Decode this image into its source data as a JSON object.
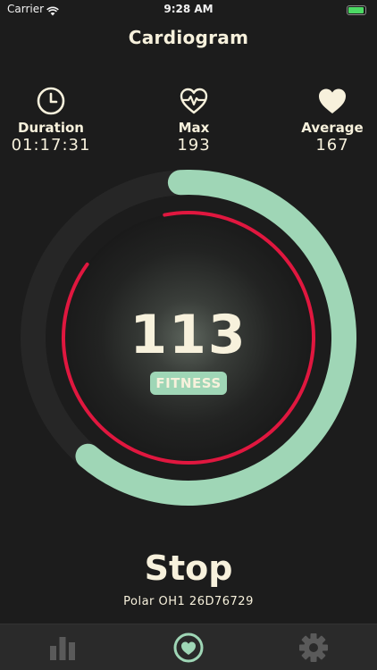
{
  "status_bar": {
    "carrier": "Carrier",
    "time": "9:28 AM"
  },
  "title": "Cardiogram",
  "stats": {
    "duration": {
      "label": "Duration",
      "value": "01:17:31",
      "icon": "clock-icon"
    },
    "max": {
      "label": "Max",
      "value": "193",
      "icon": "heartbeat-outline-icon"
    },
    "average": {
      "label": "Average",
      "value": "167",
      "icon": "heart-filled-icon"
    }
  },
  "gauge": {
    "bpm": "113",
    "zone": "FITNESS",
    "outer_progress_percent": 62,
    "inner_ring_percent": 88
  },
  "stop_label": "Stop",
  "device": "Polar OH1 26D76729",
  "tabs": [
    {
      "name": "stats",
      "icon": "bar-chart-icon",
      "active": false
    },
    {
      "name": "heart",
      "icon": "heart-circle-icon",
      "active": true
    },
    {
      "name": "settings",
      "icon": "gear-icon",
      "active": false
    }
  ],
  "colors": {
    "background": "#1c1c1c",
    "text": "#f7f1dc",
    "accent_green": "#9fd6b6",
    "ring_red": "#e0173f",
    "tab_bar": "#2a2a2a",
    "tab_icon_inactive": "#5a5a5a",
    "tab_icon_active": "#9fd6b6"
  }
}
